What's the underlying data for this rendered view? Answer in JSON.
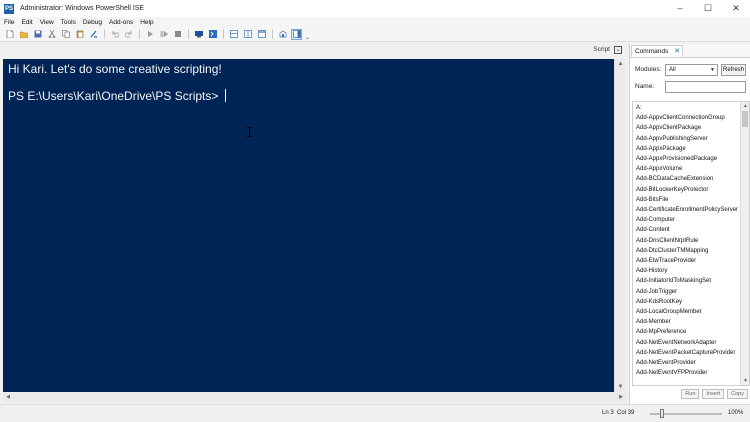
{
  "window": {
    "title": "Administrator: Windows PowerShell ISE",
    "icon": "PS"
  },
  "window_controls": {
    "minimize": "–",
    "maximize": "☐",
    "close": "✕"
  },
  "menu": [
    "File",
    "Edit",
    "View",
    "Tools",
    "Debug",
    "Add-ons",
    "Help"
  ],
  "toolbar_icons": [
    "new-script-icon",
    "open-icon",
    "save-icon",
    "cut-icon",
    "copy-icon",
    "paste-icon",
    "clear-console-icon",
    "undo-icon",
    "redo-icon",
    "run-icon",
    "run-selection-icon",
    "stop-icon",
    "remote-powershell-icon",
    "powershell-console-icon",
    "layout-top-icon",
    "layout-right-icon",
    "layout-max-icon",
    "show-commands-icon",
    "show-command-addon-icon"
  ],
  "tab_bar": {
    "script_label": "Script",
    "toggle_glyph": "⌄"
  },
  "console": {
    "lines": [
      "Hi Kari. Let's do some creative scripting!",
      "",
      "PS E:\\Users\\Kari\\OneDrive\\PS Scripts> "
    ]
  },
  "commands_panel": {
    "tab_label": "Commands",
    "close_glyph": "✕",
    "modules_label": "Modules:",
    "modules_value": "All",
    "refresh_label": "Refresh",
    "name_label": "Name:",
    "name_value": "",
    "commands": [
      "A:",
      "Add-AppvClientConnectionGroup",
      "Add-AppvClientPackage",
      "Add-AppvPublishingServer",
      "Add-AppxPackage",
      "Add-AppxProvisionedPackage",
      "Add-AppxVolume",
      "Add-BCDataCacheExtension",
      "Add-BitLockerKeyProtector",
      "Add-BitsFile",
      "Add-CertificateEnrollmentPolicyServer",
      "Add-Computer",
      "Add-Content",
      "Add-DnsClientNrptRule",
      "Add-DtcClusterTMMapping",
      "Add-EtwTraceProvider",
      "Add-History",
      "Add-InitiatorIdToMaskingSet",
      "Add-JobTrigger",
      "Add-KdsRootKey",
      "Add-LocalGroupMember",
      "Add-Member",
      "Add-MpPreference",
      "Add-NetEventNetworkAdapter",
      "Add-NetEventPacketCaptureProvider",
      "Add-NetEventProvider",
      "Add-NetEventVFPProvider"
    ],
    "buttons": [
      "Run",
      "Insert",
      "Copy"
    ]
  },
  "status": {
    "line": "Ln 3",
    "column": "Col 39",
    "zoom": "100%",
    "zoom_level_percent": 100
  }
}
